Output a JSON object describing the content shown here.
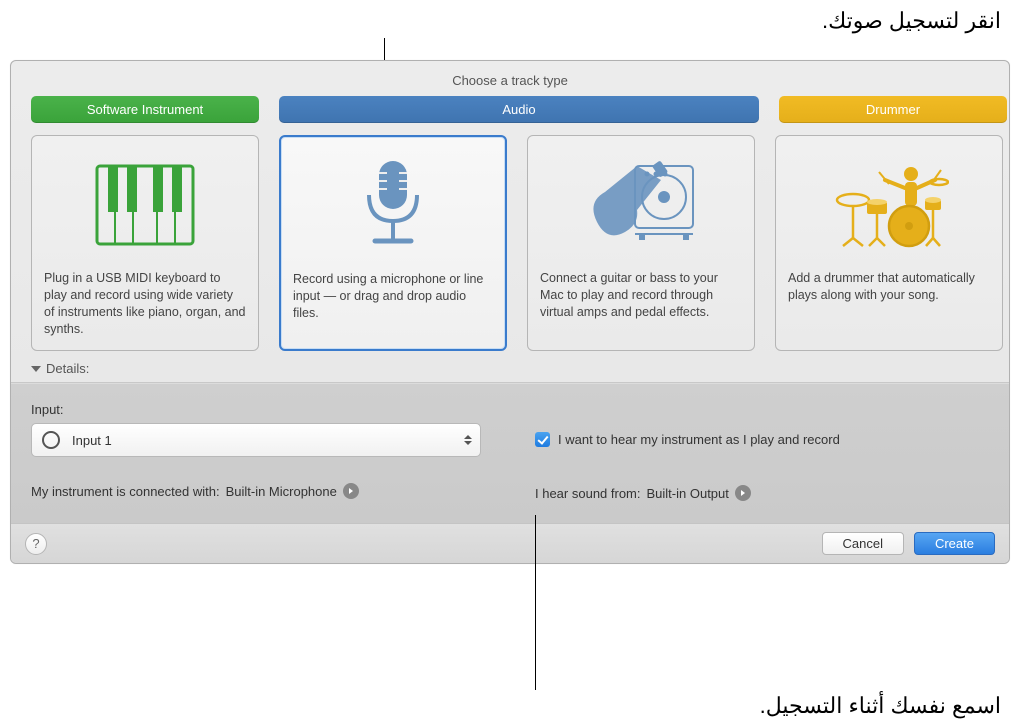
{
  "callouts": {
    "top": "انقر لتسجيل صوتك.",
    "bottom": "اسمع نفسك أثناء التسجيل."
  },
  "dialog": {
    "title": "Choose a track type",
    "tabs": {
      "software": "Software Instrument",
      "audio": "Audio",
      "drummer": "Drummer"
    },
    "cards": {
      "software": "Plug in a USB MIDI keyboard to play and record using wide variety of instruments like piano, organ, and synths.",
      "mic": "Record using a microphone or line input — or drag and drop audio files.",
      "guitar": "Connect a guitar or bass to your Mac to play and record through virtual amps and pedal effects.",
      "drummer": "Add a drummer that automatically plays along with your song."
    },
    "details": {
      "header": "Details:",
      "input_label": "Input:",
      "input_value": "Input 1",
      "connected_label": "My instrument is connected with:",
      "connected_value": "Built-in Microphone",
      "hear_checkbox": "I want to hear my instrument as I play and record",
      "output_label": "I hear sound from:",
      "output_value": "Built-in Output"
    },
    "footer": {
      "help": "?",
      "cancel": "Cancel",
      "create": "Create"
    }
  }
}
